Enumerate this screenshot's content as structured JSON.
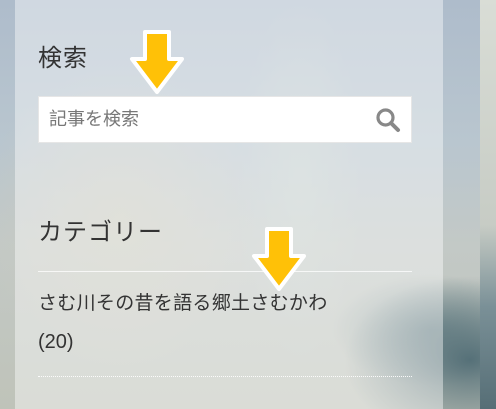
{
  "search": {
    "title": "検索",
    "placeholder": "記事を検索",
    "value": ""
  },
  "categories": {
    "title": "カテゴリー",
    "items": [
      {
        "label": "さむ川その昔を語る郷土さむかわ",
        "count": "(20)"
      }
    ]
  },
  "icons": {
    "search_button": "magnifier-icon",
    "annotation": "down-arrow-icon"
  },
  "colors": {
    "annotation_arrow": "#ffc107",
    "annotation_outline": "#ffffff",
    "text": "#333333",
    "search_icon": "#888888"
  }
}
